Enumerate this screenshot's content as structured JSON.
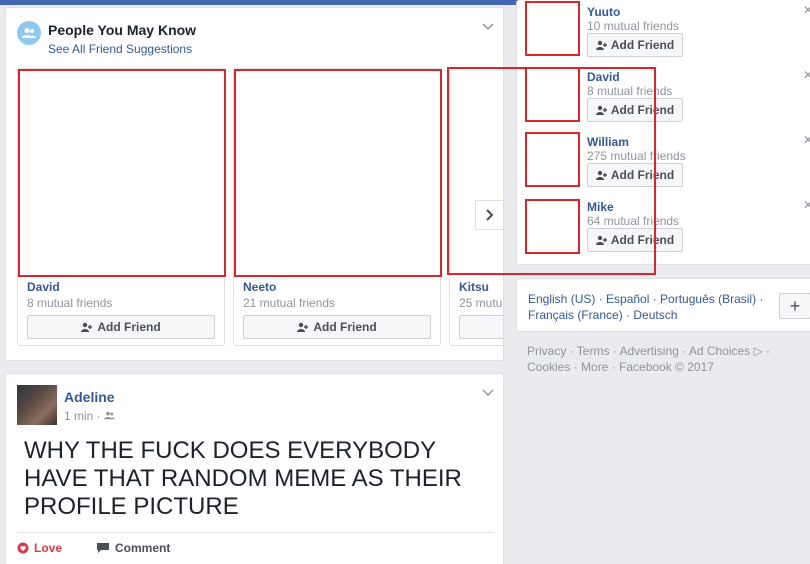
{
  "pymk": {
    "title": "People You May Know",
    "link": "See All Friend Suggestions",
    "suggestions": [
      {
        "name": "David",
        "mutual": "8 mutual friends",
        "button": "Add Friend"
      },
      {
        "name": "Neeto",
        "mutual": "21 mutual friends",
        "button": "Add Friend"
      },
      {
        "name": "Kitsu",
        "mutual": "25 mutu",
        "button": ""
      }
    ]
  },
  "post": {
    "author": "Adeline",
    "time": "1 min ·",
    "text": "WHY THE FUCK DOES EVERYBODY HAVE THAT RANDOM MEME AS THEIR PROFILE PICTURE",
    "love": "Love",
    "comment": "Comment"
  },
  "sidebar": {
    "people": [
      {
        "name": "Yuuto",
        "mutual": "10 mutual friends",
        "button": "Add Friend"
      },
      {
        "name": "David",
        "mutual": "8 mutual friends",
        "button": "Add Friend"
      },
      {
        "name": "William",
        "mutual": "275 mutual friends",
        "button": "Add Friend"
      },
      {
        "name": "Mike",
        "mutual": "64 mutual friends",
        "button": "Add Friend"
      }
    ]
  },
  "languages": {
    "list": "English (US) · Español · Português (Brasil) · Français (France) · Deutsch",
    "plus": "+"
  },
  "footer": {
    "text": "Privacy · Terms · Advertising · Ad Choices ▷ · Cookies · More · Facebook © 2017"
  },
  "colors": {
    "link": "#365899",
    "highlight_box": "#d9252b",
    "brand": "#4267b2",
    "love": "#e0394d"
  }
}
